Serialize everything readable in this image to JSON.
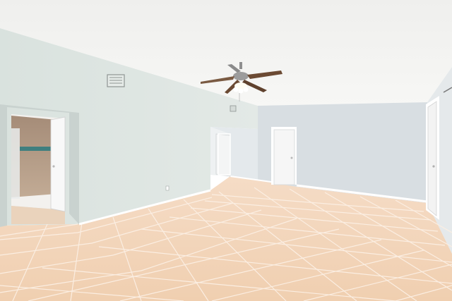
{
  "scene": {
    "kind": "photo",
    "subject": "empty-room",
    "colors": {
      "ceiling": "#f3f3f1",
      "wall_left": "#dfe6e3",
      "wall_back": "#d9dfe3",
      "wall_right": "#e6eaec",
      "floor": "#f0d2b6",
      "grout": "#ffffff",
      "door": "#f8f8f8",
      "baseboard": "#ffffff",
      "fan_blade": "#6b4a33",
      "fan_body": "#9a9a9a",
      "bath_tile": "#b59b84",
      "bath_accent": "#3f7f7f"
    }
  }
}
